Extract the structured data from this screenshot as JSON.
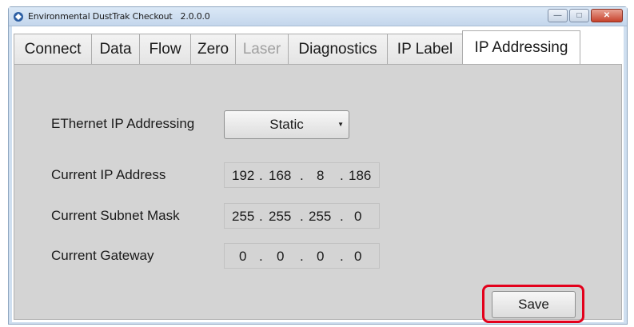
{
  "window": {
    "title": "Environmental DustTrak Checkout",
    "version": "2.0.0.0",
    "minimize_icon": "minimize-icon",
    "maximize_icon": "maximize-icon",
    "close_icon": "close-icon"
  },
  "tabs": [
    {
      "label": "Connect"
    },
    {
      "label": "Data"
    },
    {
      "label": "Flow"
    },
    {
      "label": "Zero"
    },
    {
      "label": "Laser"
    },
    {
      "label": "Diagnostics"
    },
    {
      "label": "IP Label"
    },
    {
      "label": "IP Addressing"
    }
  ],
  "ip_addressing": {
    "mode_label": "EThernet IP Addressing",
    "mode_value": "Static",
    "ip_label": "Current IP Address",
    "ip": [
      "192",
      "168",
      "8",
      "186"
    ],
    "subnet_label": "Current Subnet Mask",
    "subnet": [
      "255",
      "255",
      "255",
      "0"
    ],
    "gateway_label": "Current Gateway",
    "gateway": [
      "0",
      "0",
      "0",
      "0"
    ],
    "save_label": "Save"
  },
  "colors": {
    "highlight": "#e3001b"
  }
}
